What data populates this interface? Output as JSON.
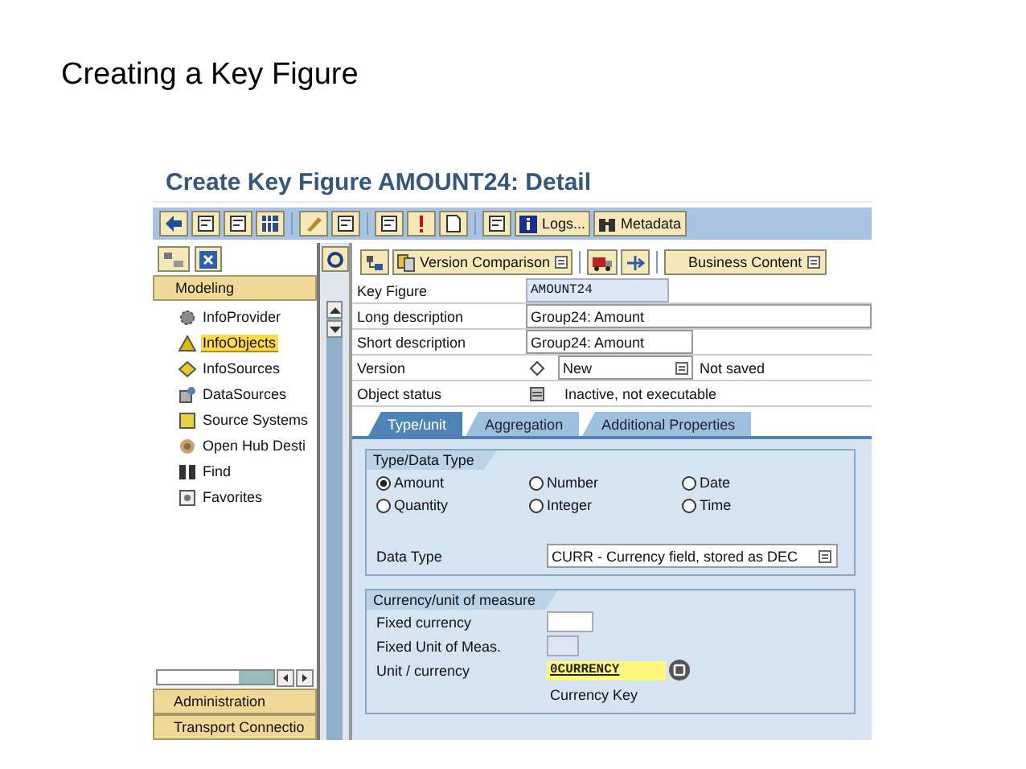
{
  "slide_title": "Creating a Key Figure",
  "window": {
    "title": "Create Key Figure AMOUNT24: Detail"
  },
  "toolbar": {
    "text_buttons": [
      "Logs...",
      "Metadata"
    ]
  },
  "navigator": {
    "active_section": "Modeling",
    "items": [
      {
        "label": "InfoProvider",
        "selected": false
      },
      {
        "label": "InfoObjects",
        "selected": true
      },
      {
        "label": "InfoSources",
        "selected": false
      },
      {
        "label": "DataSources",
        "selected": false
      },
      {
        "label": "Source Systems",
        "selected": false
      },
      {
        "label": "Open Hub Desti",
        "selected": false
      },
      {
        "label": "Find",
        "selected": false
      },
      {
        "label": "Favorites",
        "selected": false
      }
    ],
    "other_sections": [
      "Administration",
      "Transport Connectio"
    ]
  },
  "app_toolbar": {
    "buttons": [
      "Version Comparison",
      "Business Content"
    ]
  },
  "header_fields": [
    {
      "label": "Key Figure",
      "value": "AMOUNT24",
      "kind": "display"
    },
    {
      "label": "Long description",
      "value": "Group24: Amount",
      "kind": "wide"
    },
    {
      "label": "Short description",
      "value": "Group24: Amount",
      "kind": "input"
    },
    {
      "label": "Version",
      "value": "New",
      "kind": "dropdown",
      "note": "Not saved"
    },
    {
      "label": "Object status",
      "value": "Inactive, not executable",
      "kind": "status"
    }
  ],
  "tabs": [
    {
      "label": "Type/unit",
      "selected": true
    },
    {
      "label": "Aggregation",
      "selected": false
    },
    {
      "label": "Additional Properties",
      "selected": false
    }
  ],
  "type_group": {
    "title": "Type/Data Type",
    "options": [
      {
        "label": "Amount",
        "selected": true
      },
      {
        "label": "Number",
        "selected": false
      },
      {
        "label": "Date",
        "selected": false
      },
      {
        "label": "Quantity",
        "selected": false
      },
      {
        "label": "Integer",
        "selected": false
      },
      {
        "label": "Time",
        "selected": false
      }
    ],
    "data_type": {
      "label": "Data Type",
      "value": "CURR - Currency field, stored as DEC"
    }
  },
  "currency_group": {
    "title": "Currency/unit of measure",
    "fields": [
      {
        "label": "Fixed currency",
        "kind": "input"
      },
      {
        "label": "Fixed Unit of Meas.",
        "kind": "disabled"
      },
      {
        "label": "Unit / currency",
        "kind": "required",
        "value": "0CURRENCY",
        "description": "Currency Key"
      }
    ]
  }
}
